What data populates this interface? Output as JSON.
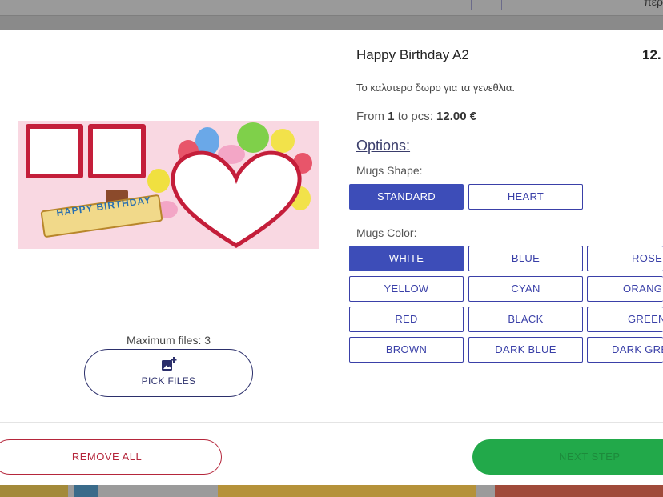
{
  "background": {
    "corner_text": "περ",
    "accent_divider": "#6b6b8a"
  },
  "product": {
    "title": "Happy Birthday A2",
    "price_corner": "12.",
    "description": "Το καλυτερο δωρο για τα γενεθλια.",
    "price_prefix": "From",
    "price_qty": "1",
    "price_mid": "to pcs:",
    "price_value": "12.00 €",
    "image_banner_text": "HAPPY BIRTHDAY"
  },
  "upload": {
    "max_files": "Maximum files: 3",
    "pick_files_label": "PICK FILES"
  },
  "options": {
    "heading": "Options:",
    "shape_label": "Mugs Shape:",
    "shapes": [
      "STANDARD",
      "HEART"
    ],
    "shape_selected": "STANDARD",
    "color_label": "Mugs Color:",
    "colors": [
      "WHITE",
      "BLUE",
      "ROSE",
      "YELLOW",
      "CYAN",
      "ORANGE",
      "RED",
      "BLACK",
      "GREEN",
      "BROWN",
      "DARK BLUE",
      "DARK GREEN"
    ],
    "color_selected": "WHITE"
  },
  "footer": {
    "remove_all": "REMOVE ALL",
    "next_step": "NEXT STEP"
  },
  "colors": {
    "primary": "#3d4db8",
    "danger": "#b5263b",
    "success": "#22a94a"
  }
}
